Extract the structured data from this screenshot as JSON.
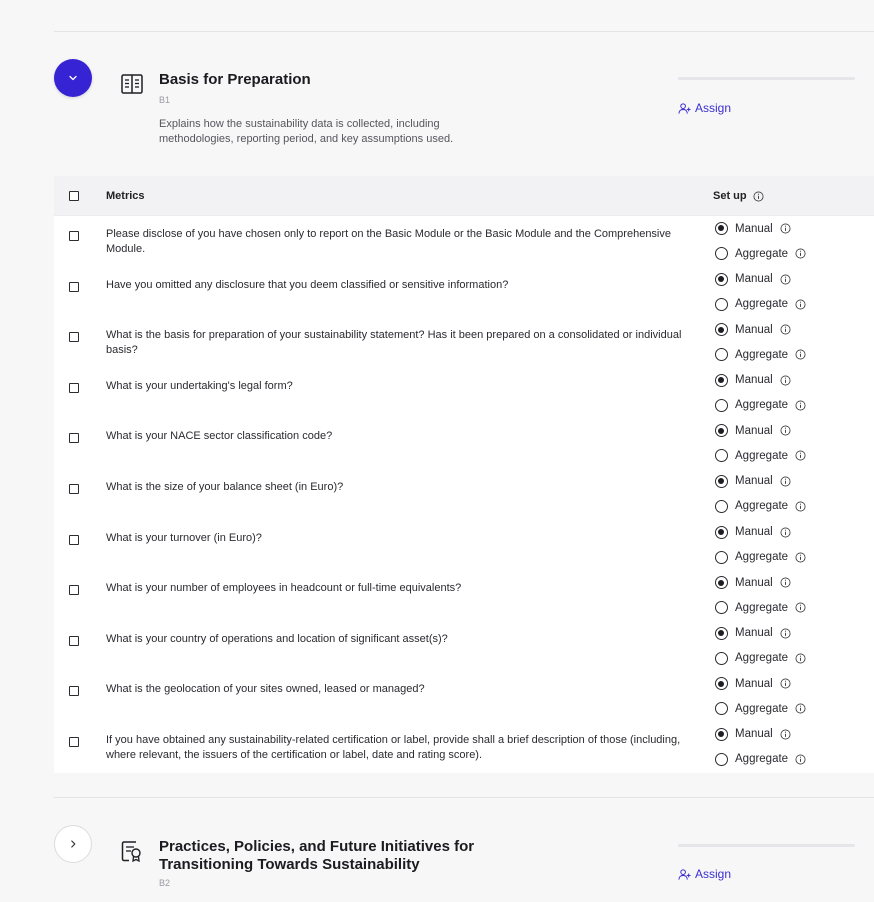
{
  "section1": {
    "title": "Basis for Preparation",
    "code": "B1",
    "description_line1": "Explains how the sustainability data is collected, including",
    "description_line2": "methodologies, reporting period, and key assumptions used.",
    "assign_label": "Assign",
    "icon": "book-columns-icon",
    "expanded": true
  },
  "table": {
    "metrics_header": "Metrics",
    "setup_header": "Set up",
    "rows": [
      {
        "question": "Please disclose of you have chosen only to report on the Basic Module or the Basic Module and the Comprehensive Module.",
        "manual": "Manual",
        "aggregate": "Aggregate",
        "selected": "manual"
      },
      {
        "question": "Have you omitted any disclosure that you deem classified or sensitive information?",
        "manual": "Manual",
        "aggregate": "Aggregate",
        "selected": "manual"
      },
      {
        "question": "What is the basis for preparation of your sustainability statement? Has it been prepared on a consolidated or individual basis?",
        "manual": "Manual",
        "aggregate": "Aggregate",
        "selected": "manual"
      },
      {
        "question": "What is your undertaking's legal form?",
        "manual": "Manual",
        "aggregate": "Aggregate",
        "selected": "manual"
      },
      {
        "question": "What is your NACE sector classification code?",
        "manual": "Manual",
        "aggregate": "Aggregate",
        "selected": "manual"
      },
      {
        "question": "What is the size of your balance sheet (in Euro)?",
        "manual": "Manual",
        "aggregate": "Aggregate",
        "selected": "manual"
      },
      {
        "question": "What is your turnover (in Euro)?",
        "manual": "Manual",
        "aggregate": "Aggregate",
        "selected": "manual"
      },
      {
        "question": "What is your number of employees in headcount or full-time equivalents?",
        "manual": "Manual",
        "aggregate": "Aggregate",
        "selected": "manual"
      },
      {
        "question": "What is your country of operations and location of significant asset(s)?",
        "manual": "Manual",
        "aggregate": "Aggregate",
        "selected": "manual"
      },
      {
        "question": "What is the geolocation of your sites owned, leased or managed?",
        "manual": "Manual",
        "aggregate": "Aggregate",
        "selected": "manual"
      },
      {
        "question": "If you have obtained any sustainability-related certification or label, provide shall a brief description of those (including, where relevant, the issuers of the certification or label, date and rating score).",
        "manual": "Manual",
        "aggregate": "Aggregate",
        "selected": "manual"
      }
    ]
  },
  "section2": {
    "title_line1": "Practices, Policies, and Future Initiatives for",
    "title_line2": "Transitioning Towards Sustainability",
    "code": "B2",
    "assign_label": "Assign",
    "icon": "document-badge-icon",
    "expanded": false
  },
  "colors": {
    "accent": "#3623d4",
    "link": "#3b2fd0"
  }
}
